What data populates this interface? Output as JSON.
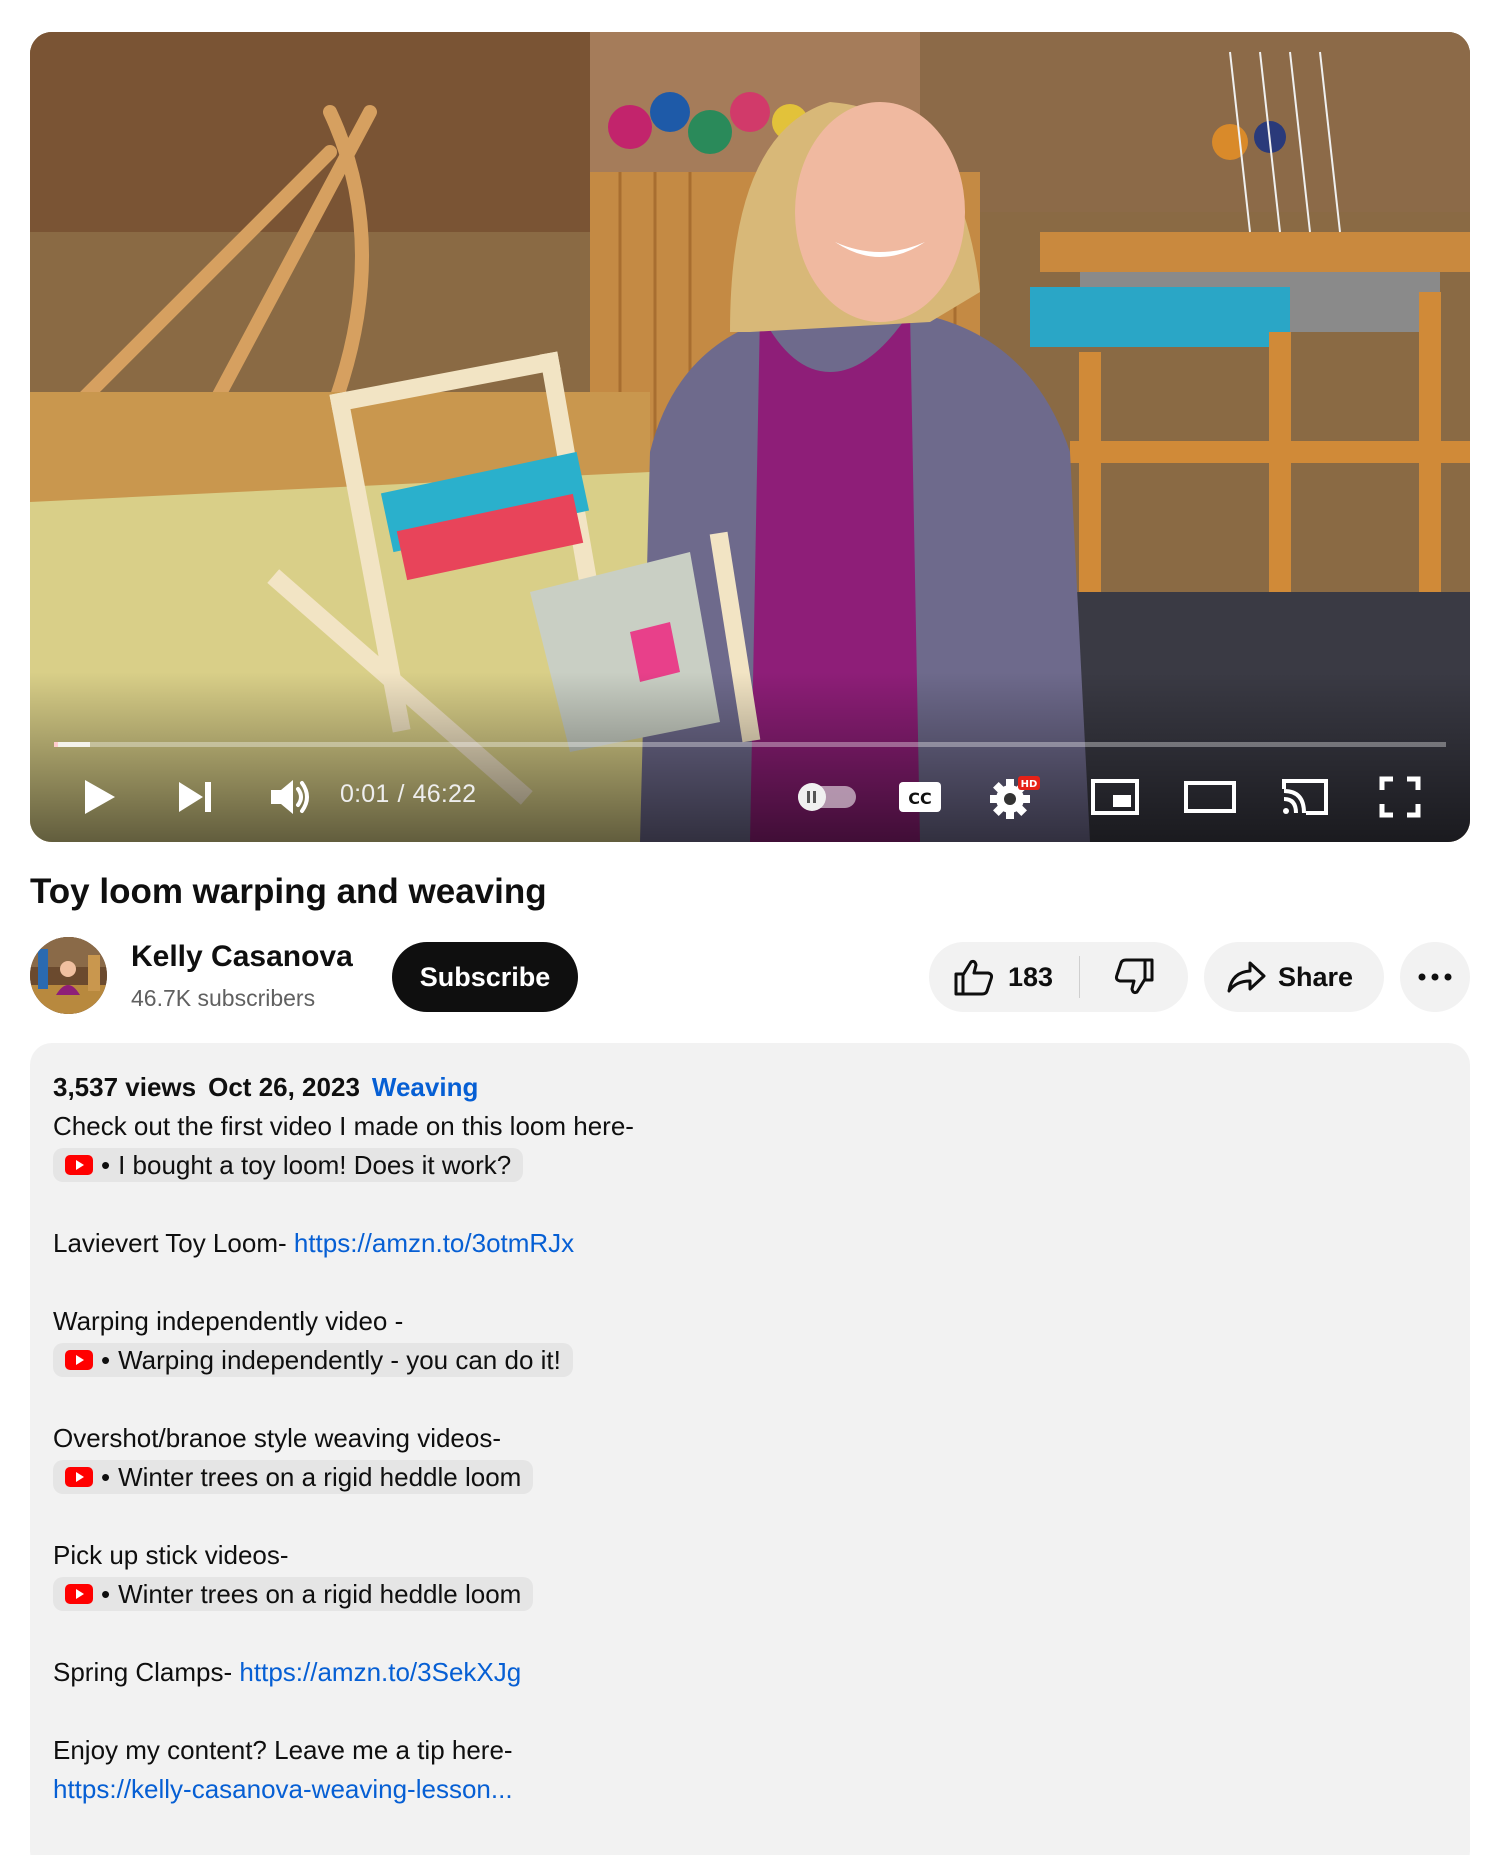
{
  "player": {
    "time_current": "0:01",
    "time_separator": "/",
    "time_total": "46:22",
    "progress_fraction": 0.0004,
    "hd_badge": "HD",
    "cc_label": "CC"
  },
  "video": {
    "title": "Toy loom warping and weaving"
  },
  "channel": {
    "name": "Kelly Casanova",
    "subscribers": "46.7K subscribers",
    "subscribe_label": "Subscribe"
  },
  "actions": {
    "like_count": "183",
    "share_label": "Share"
  },
  "description": {
    "views": "3,537 views",
    "date": "Oct 26, 2023",
    "tag": "Weaving",
    "lines": {
      "first_video": "Check out the first video I made on this loom here-",
      "chip1": "I bought a toy loom! Does it work?",
      "toy_loom_label": "Lavievert Toy Loom- ",
      "toy_loom_link": "https://amzn.to/3otmRJx",
      "warping_label": "Warping independently video -",
      "chip2": "Warping independently - you can do it!",
      "overshot_label": "Overshot/branoe style weaving videos-",
      "chip3": "Winter trees on a rigid heddle loom",
      "pickup_label": "Pick up stick videos-",
      "chip4": "Winter trees on a rigid heddle loom",
      "clamps_label": "Spring Clamps- ",
      "clamps_link": "https://amzn.to/3SekXJg",
      "tip_label": "Enjoy my content? Leave me a tip here-",
      "tip_link": "https://kelly-casanova-weaving-lesson..."
    },
    "chip_separator": "•"
  },
  "colors": {
    "link": "#065fd4",
    "yt_red": "#ff0000",
    "pill_bg": "#f2f2f2",
    "subscribe_bg": "#0f0f0f"
  },
  "icons": {
    "play": "play-icon",
    "next": "next-icon",
    "volume": "volume-icon",
    "autoplay": "autoplay-toggle-icon",
    "cc": "captions-icon",
    "settings": "gear-icon",
    "miniplayer": "miniplayer-icon",
    "theater": "theater-mode-icon",
    "cast": "cast-icon",
    "fullscreen": "fullscreen-icon",
    "like": "thumbs-up-icon",
    "dislike": "thumbs-down-icon",
    "share": "share-arrow-icon",
    "more": "more-dots-icon",
    "youtube": "youtube-logo-icon"
  }
}
